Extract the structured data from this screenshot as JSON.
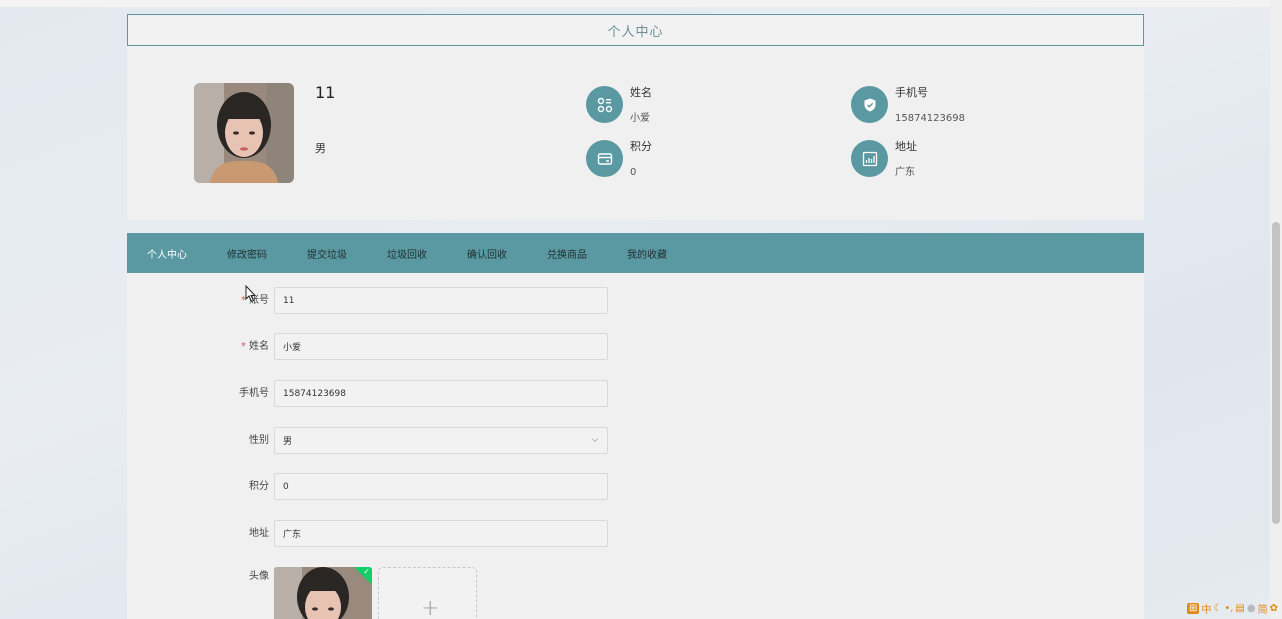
{
  "header": {
    "title": "个人中心"
  },
  "profile": {
    "username": "11",
    "gender": "男",
    "items": {
      "name": {
        "label": "姓名",
        "value": "小爱"
      },
      "phone": {
        "label": "手机号",
        "value": "15874123698"
      },
      "points": {
        "label": "积分",
        "value": "0"
      },
      "address": {
        "label": "地址",
        "value": "广东"
      }
    }
  },
  "tabs": [
    "个人中心",
    "修改密码",
    "提交垃圾",
    "垃圾回收",
    "确认回收",
    "兑换商品",
    "我的收藏"
  ],
  "form": {
    "account": {
      "label": "账号",
      "value": "11"
    },
    "name": {
      "label": "姓名",
      "value": "小爱"
    },
    "phone": {
      "label": "手机号",
      "value": "15874123698"
    },
    "gender": {
      "label": "性别",
      "value": "男"
    },
    "points": {
      "label": "积分",
      "value": "0"
    },
    "address": {
      "label": "地址",
      "value": "广东"
    },
    "avatar": {
      "label": "头像",
      "add_symbol": "+",
      "check": "✓"
    }
  },
  "ime": [
    "中",
    "简"
  ],
  "colors": {
    "accent": "#5a99a1",
    "success": "#13ce66",
    "required": "#e05050"
  },
  "icons": [
    "apps-icon",
    "shield-icon",
    "wallet-icon",
    "chart-icon",
    "chevron-down-icon",
    "plus-icon",
    "check-icon",
    "cursor-icon"
  ]
}
